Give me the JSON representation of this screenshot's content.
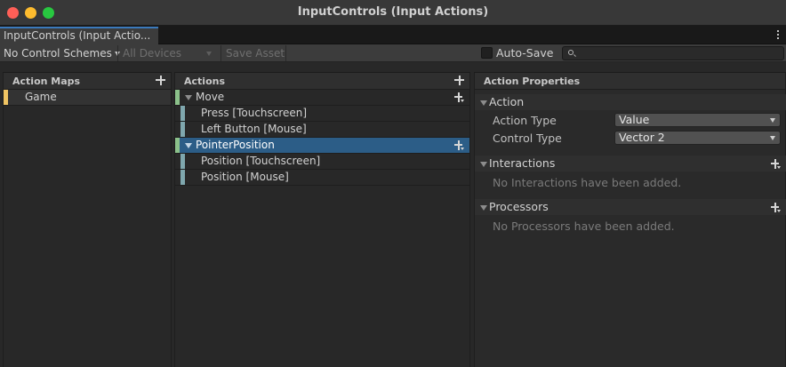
{
  "window": {
    "title": "InputControls (Input Actions)"
  },
  "tab": {
    "label": "InputControls (Input Actio..."
  },
  "toolbar": {
    "control_scheme": "No Control Schemes",
    "devices": "All Devices",
    "save_asset": "Save Asset",
    "auto_save_label": "Auto-Save",
    "auto_save_checked": false,
    "search_value": ""
  },
  "action_maps": {
    "title": "Action Maps",
    "items": [
      {
        "label": "Game",
        "color": "#f0c463"
      }
    ]
  },
  "actions": {
    "title": "Actions",
    "items": [
      {
        "label": "Move",
        "kind": "action",
        "color": "#8bc08a"
      },
      {
        "label": "Press [Touchscreen]",
        "kind": "binding",
        "color": "#7fa7ae"
      },
      {
        "label": "Left Button [Mouse]",
        "kind": "binding",
        "color": "#7fa7ae"
      },
      {
        "label": "PointerPosition",
        "kind": "action",
        "color": "#8bc08a",
        "selected": true
      },
      {
        "label": "Position [Touchscreen]",
        "kind": "binding",
        "color": "#7fa7ae"
      },
      {
        "label": "Position [Mouse]",
        "kind": "binding",
        "color": "#7fa7ae"
      }
    ]
  },
  "properties": {
    "title": "Action Properties",
    "action": {
      "header": "Action",
      "action_type_label": "Action Type",
      "action_type_value": "Value",
      "control_type_label": "Control Type",
      "control_type_value": "Vector 2"
    },
    "interactions": {
      "header": "Interactions",
      "empty": "No Interactions have been added."
    },
    "processors": {
      "header": "Processors",
      "empty": "No Processors have been added."
    }
  }
}
